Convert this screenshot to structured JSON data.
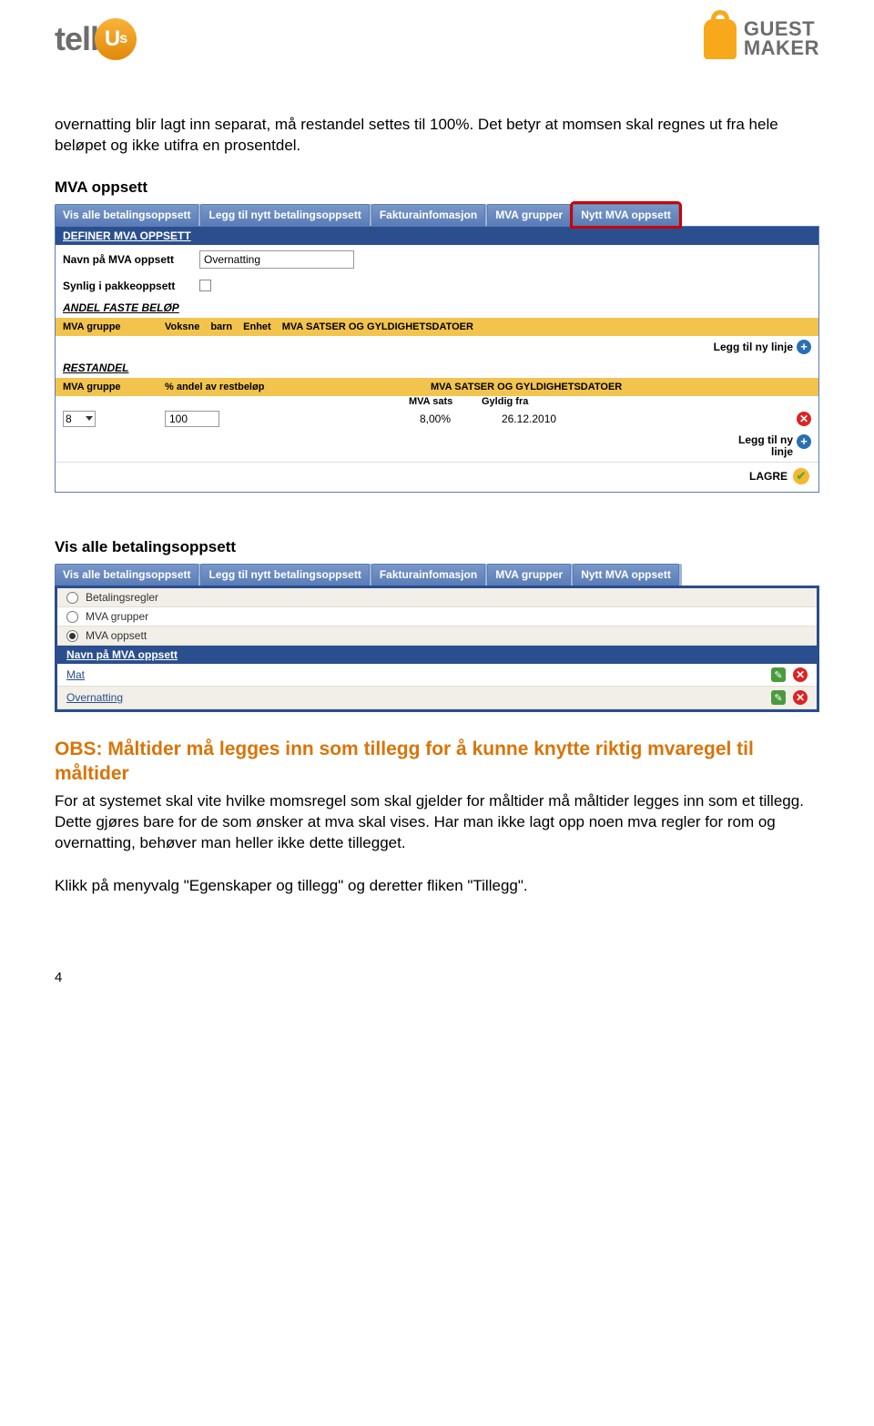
{
  "logos": {
    "tellus_a": "tell",
    "tellus_b": "U",
    "tellus_c": "s",
    "gm1": "GUEST",
    "gm2": "MAKER"
  },
  "intro_para": "overnatting blir lagt inn separat, må restandel settes til 100%. Det betyr at momsen skal regnes ut fra hele beløpet og ikke utifra en prosentdel.",
  "section1": {
    "title": "MVA oppsett",
    "tabs": [
      "Vis alle betalingsoppsett",
      "Legg til nytt betalingsoppsett",
      "Fakturainfomasjon",
      "MVA grupper",
      "Nytt MVA oppsett"
    ],
    "panel_header": "DEFINER MVA OPPSETT",
    "name_label": "Navn på MVA oppsett",
    "name_value": "Overnatting",
    "visible_label": "Synlig i pakkeoppsett",
    "fixed_heading": "ANDEL FASTE BELØP",
    "cols1": {
      "gruppe": "MVA gruppe",
      "voksne": "Voksne",
      "barn": "barn",
      "enhet": "Enhet",
      "satser": "MVA SATSER OG GYLDIGHETSDATOER"
    },
    "add_line": "Legg til ny linje",
    "rest_heading": "RESTANDEL",
    "cols2": {
      "gruppe": "MVA gruppe",
      "andel": "% andel av restbeløp",
      "satser": "MVA SATSER OG GYLDIGHETSDATOER",
      "sats": "MVA sats",
      "gyldig": "Gyldig fra"
    },
    "row": {
      "gruppe": "8",
      "andel": "100",
      "sats": "8,00%",
      "gyldig": "26.12.2010"
    },
    "add_line2a": "Legg til ny",
    "add_line2b": "linje",
    "save": "LAGRE"
  },
  "section2": {
    "title": "Vis alle betalingsoppsett",
    "tabs": [
      "Vis alle betalingsoppsett",
      "Legg til nytt betalingsoppsett",
      "Fakturainfomasjon",
      "MVA grupper",
      "Nytt MVA oppsett"
    ],
    "radios": [
      "Betalingsregler",
      "MVA grupper",
      "MVA oppsett"
    ],
    "list_header": "Navn på MVA oppsett",
    "rows": [
      "Mat",
      "Overnatting"
    ]
  },
  "obs": "OBS: Måltider må legges inn som tillegg for å kunne knytte riktig mvaregel til måltider",
  "obs_body": "For at systemet skal vite hvilke momsregel som skal gjelder for måltider må måltider legges inn som et tillegg. Dette gjøres bare for de som ønsker at mva skal vises. Har man ikke lagt opp noen mva regler for rom og overnatting, behøver man heller ikke dette tillegget.",
  "obs_body2": "Klikk på menyvalg \"Egenskaper og tillegg\" og deretter fliken \"Tillegg\".",
  "page_number": "4"
}
